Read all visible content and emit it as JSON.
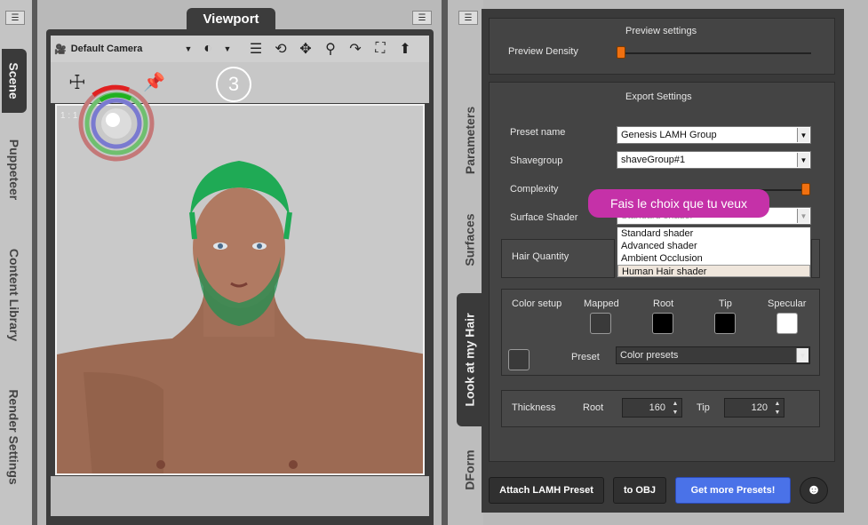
{
  "left_tabs": [
    {
      "label": "Scene",
      "active": true
    },
    {
      "label": "Puppeteer",
      "active": false
    },
    {
      "label": "Content Library",
      "active": false
    },
    {
      "label": "Render Settings",
      "active": false
    }
  ],
  "viewport": {
    "tab_label": "Viewport",
    "camera_label": "Default Camera",
    "step_badge": "3",
    "aspect_label": "1 : 1"
  },
  "right_tabs": [
    {
      "label": "Parameters",
      "active": false
    },
    {
      "label": "Surfaces",
      "active": false
    },
    {
      "label": "Look at my Hair",
      "active": true
    },
    {
      "label": "DForm",
      "active": false
    }
  ],
  "preview": {
    "title": "Preview settings",
    "density_label": "Preview Density",
    "density_value": 0.0
  },
  "export": {
    "title": "Export Settings",
    "preset_name_label": "Preset name",
    "preset_name_value": "Genesis LAMH Group",
    "shavegroup_label": "Shavegroup",
    "shavegroup_value": "shaveGroup#1",
    "complexity_label": "Complexity",
    "complexity_value": 1.0,
    "surface_shader_label": "Surface Shader",
    "surface_shader_value": "Standard shader",
    "shader_options": [
      "Standard shader",
      "Advanced shader",
      "Ambient Occlusion",
      "Human Hair shader"
    ],
    "shader_highlighted": "Human Hair shader",
    "tooltip": "Fais le choix que tu veux"
  },
  "hair_quantity": {
    "label": "Hair Quantity"
  },
  "color_setup": {
    "label": "Color setup",
    "mapped_label": "Mapped",
    "root_label": "Root",
    "tip_label": "Tip",
    "specular_label": "Specular",
    "preset_label": "Preset",
    "preset_value": "Color presets",
    "colors": {
      "mapped": "#3a3a3a",
      "root": "#000000",
      "tip": "#000000",
      "specular": "#ffffff"
    }
  },
  "thickness": {
    "label": "Thickness",
    "root_label": "Root",
    "root_value": "160",
    "tip_label": "Tip",
    "tip_value": "120"
  },
  "buttons": {
    "attach": "Attach LAMH Preset",
    "to_obj": "to OBJ",
    "more": "Get more Presets!"
  },
  "colors": {
    "accent_orange": "#f07010",
    "tooltip_magenta": "#c531a8",
    "button_blue": "#4a72e8"
  }
}
